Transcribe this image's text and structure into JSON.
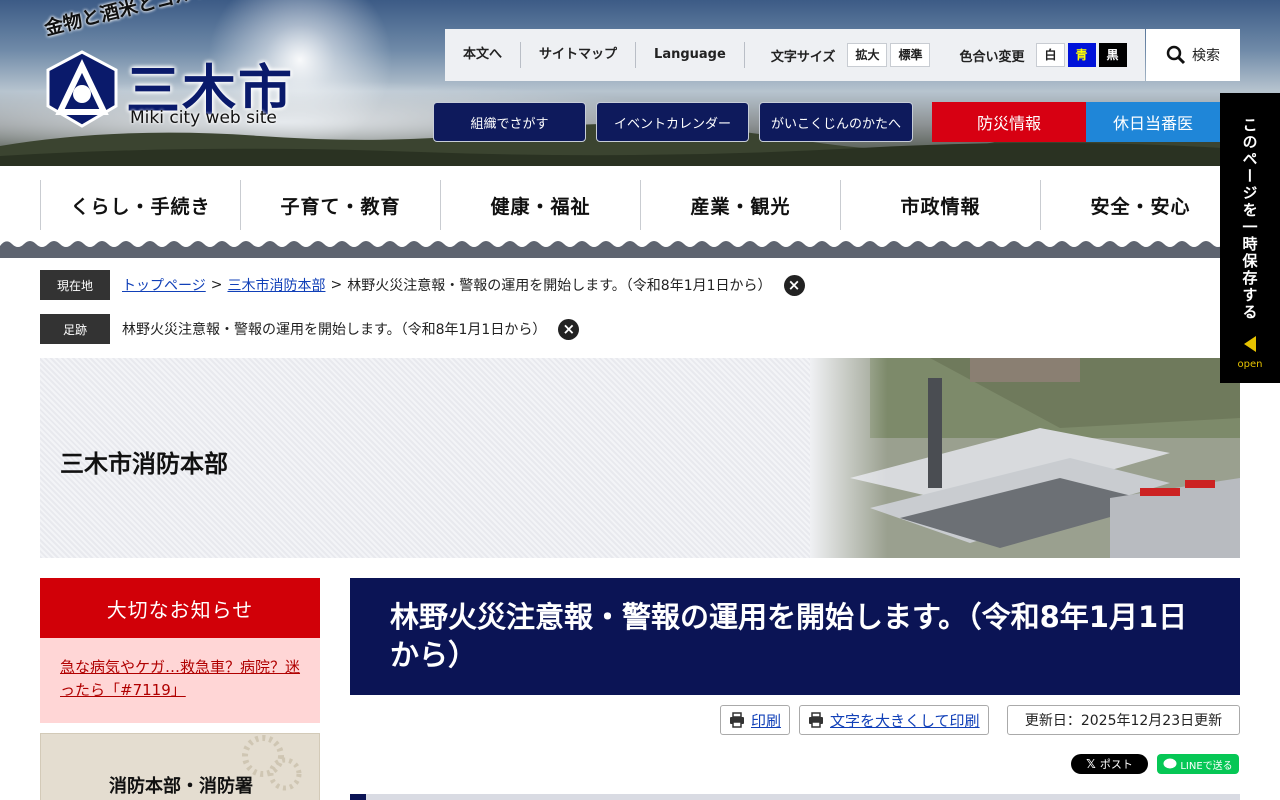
{
  "header": {
    "tagline": "金物と酒米とゴルフのまち",
    "site_name": "三木市",
    "site_name_en": "Miki city web site"
  },
  "utility": {
    "links": [
      "本文へ",
      "サイトマップ",
      "Language"
    ],
    "font_size_label": "文字サイズ",
    "font_size_buttons": [
      "拡大",
      "標準"
    ],
    "color_label": "色合い変更",
    "color_buttons": [
      "白",
      "青",
      "黒"
    ],
    "search_label": "検索"
  },
  "quick_links": [
    "組織でさがす",
    "イベントカレンダー",
    "がいこくじんのかたへ"
  ],
  "emergency": {
    "disaster": "防災情報",
    "holiday_doctor": "休日当番医"
  },
  "main_nav": [
    "くらし・手続き",
    "子育て・教育",
    "健康・福祉",
    "産業・観光",
    "市政情報",
    "安全・安心"
  ],
  "breadcrumb": {
    "current_label": "現在地",
    "links": [
      "トップページ",
      "三木市消防本部"
    ],
    "current": "林野火災注意報・警報の運用を開始します。（令和8年1月1日から）",
    "history_label": "足跡",
    "history_item": "林野火災注意報・警報の運用を開始します。（令和8年1月1日から）",
    "separator": ">"
  },
  "hero": {
    "title": "三木市消防本部"
  },
  "sidebar": {
    "notice_title": "大切なお知らせ",
    "notice_link": "急な病気やケガ…救急車？病院？迷ったら「#7119」",
    "section_title": "消防本部・消防署"
  },
  "article": {
    "title": "林野火災注意報・警報の運用を開始します。（令和8年1月1日から）",
    "print_label": "印刷",
    "print_large_label": "文字を大きくして印刷",
    "updated": "更新日：2025年12月23日更新"
  },
  "share": {
    "x_label": "ポスト",
    "line_label": "LINEで送る"
  },
  "save_tab": {
    "label": "このページを一時保存する",
    "open": "open"
  },
  "colors": {
    "navy": "#0b1455",
    "red": "#d70012",
    "blue": "#1f86d8",
    "pink": "#ffd6d6"
  }
}
